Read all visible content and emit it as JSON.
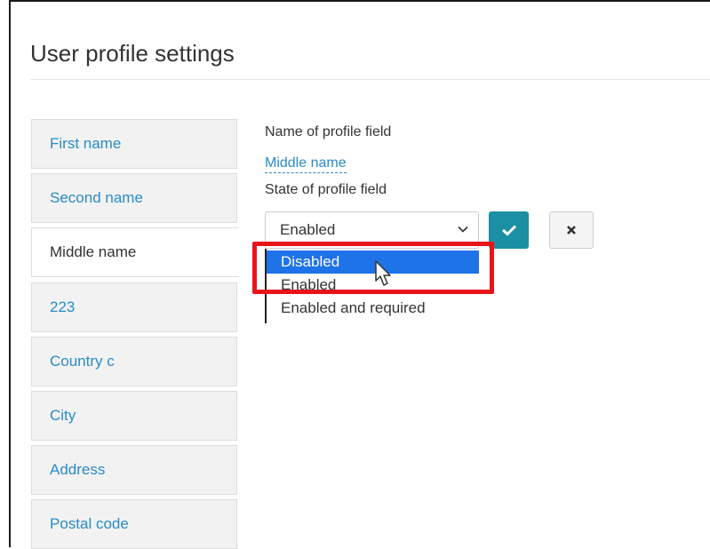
{
  "page": {
    "title": "User profile settings"
  },
  "sidebar": {
    "items": [
      {
        "label": "First name",
        "active": false
      },
      {
        "label": "Second name",
        "active": false
      },
      {
        "label": "Middle name",
        "active": true
      },
      {
        "label": "223",
        "active": false
      },
      {
        "label": "Country c",
        "active": false
      },
      {
        "label": "City",
        "active": false
      },
      {
        "label": "Address",
        "active": false
      },
      {
        "label": "Postal code",
        "active": false
      }
    ]
  },
  "form": {
    "name_label": "Name of profile field",
    "name_value": "Middle name",
    "state_label": "State of profile field",
    "state_selected": "Enabled",
    "options": [
      "Disabled",
      "Enabled",
      "Enabled and required"
    ],
    "hovered_option": "Disabled"
  },
  "colors": {
    "accent": "#2a8bc7",
    "ok_button": "#1b8fa3",
    "selection": "#1e73e8",
    "annotation": "#e8141a"
  },
  "icons": {
    "ok": "check-icon",
    "cancel": "close-icon",
    "select": "chevron-down-icon",
    "pointer": "mouse-cursor-icon"
  }
}
